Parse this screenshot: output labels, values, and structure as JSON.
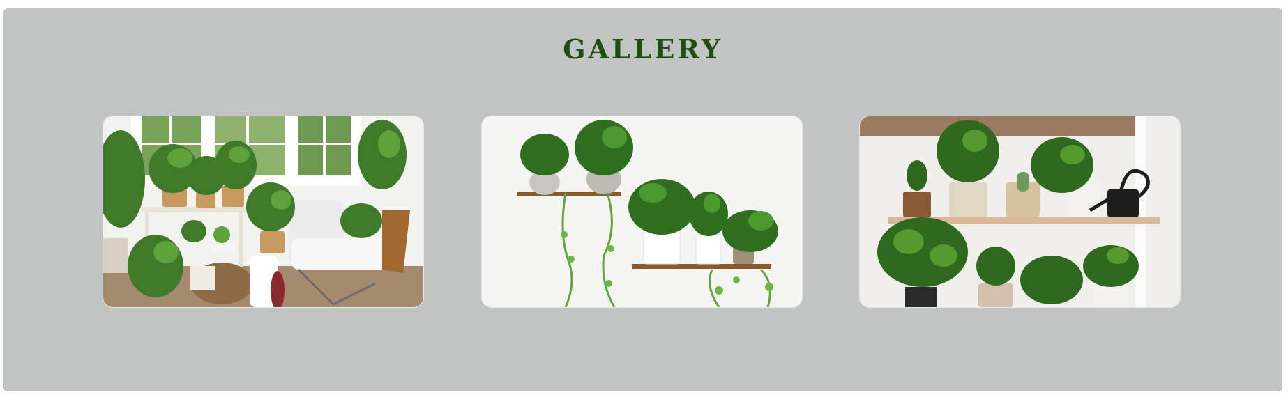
{
  "gallery": {
    "title": "GALLERY",
    "images": [
      {
        "subject": "sunroom-with-potted-plants-and-white-lounge-chair"
      },
      {
        "subject": "wall-shelves-with-trailing-pothos-and-potted-plants"
      },
      {
        "subject": "wooden-shelves-with-potted-plants-and-watering-can"
      }
    ]
  },
  "colors": {
    "panel_background": "#c0c5c3",
    "title_color": "#1f4d12"
  }
}
